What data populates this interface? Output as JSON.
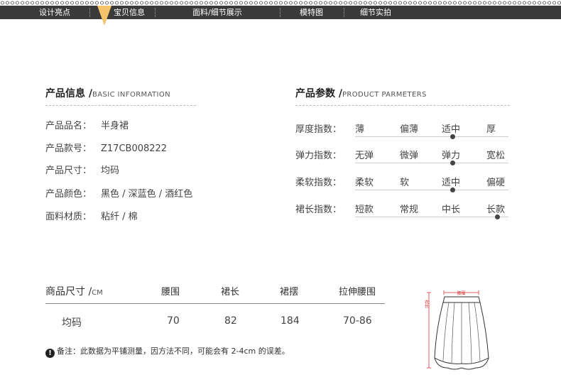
{
  "nav": {
    "items": [
      {
        "label": "设计亮点"
      },
      {
        "label": "宝贝信息"
      },
      {
        "label": "面料/细节展示"
      },
      {
        "label": "模特图"
      },
      {
        "label": "细节实拍"
      }
    ],
    "accent": "#f5c36a"
  },
  "info": {
    "title_cn": "产品信息 /",
    "title_en": "BASIC INFORMATION",
    "rows": [
      {
        "key": "产品品名：",
        "value": "半身裙"
      },
      {
        "key": "产品款号：",
        "value": "Z17CB008222"
      },
      {
        "key": "产品尺寸：",
        "value": "均码"
      },
      {
        "key": "产品颜色：",
        "value": "黑色 / 深蓝色 / 酒红色"
      },
      {
        "key": "面料材质：",
        "value": "粘纤 / 棉"
      }
    ]
  },
  "params": {
    "title_cn": "产品参数 /",
    "title_en": "PRODUCT PARMETERS",
    "rows": [
      {
        "label": "厚度指数：",
        "options": [
          "薄",
          "偏薄",
          "适中",
          "厚"
        ],
        "selected": 2
      },
      {
        "label": "弹力指数：",
        "options": [
          "无弹",
          "微弹",
          "弹力",
          "宽松"
        ],
        "selected": 2
      },
      {
        "label": "柔软指数：",
        "options": [
          "柔软",
          "软",
          "适中",
          "偏硬"
        ],
        "selected": 2
      },
      {
        "label": "裙长指数：",
        "options": [
          "短款",
          "常规",
          "中长",
          "长款"
        ],
        "selected": 3
      }
    ]
  },
  "size_table": {
    "header_first": "商品尺寸 /",
    "unit": "CM",
    "headers": [
      "腰围",
      "裙长",
      "裙摆",
      "拉伸腰围"
    ],
    "row": [
      "均码",
      "70",
      "82",
      "184",
      "70-86"
    ]
  },
  "note": {
    "icon": "!",
    "text": "备注：此数据为平铺测量，因方法不同，可能会有 2-4cm 的误差。"
  },
  "diagram": {
    "waist_label": "腰围",
    "length_label": "衣长"
  }
}
